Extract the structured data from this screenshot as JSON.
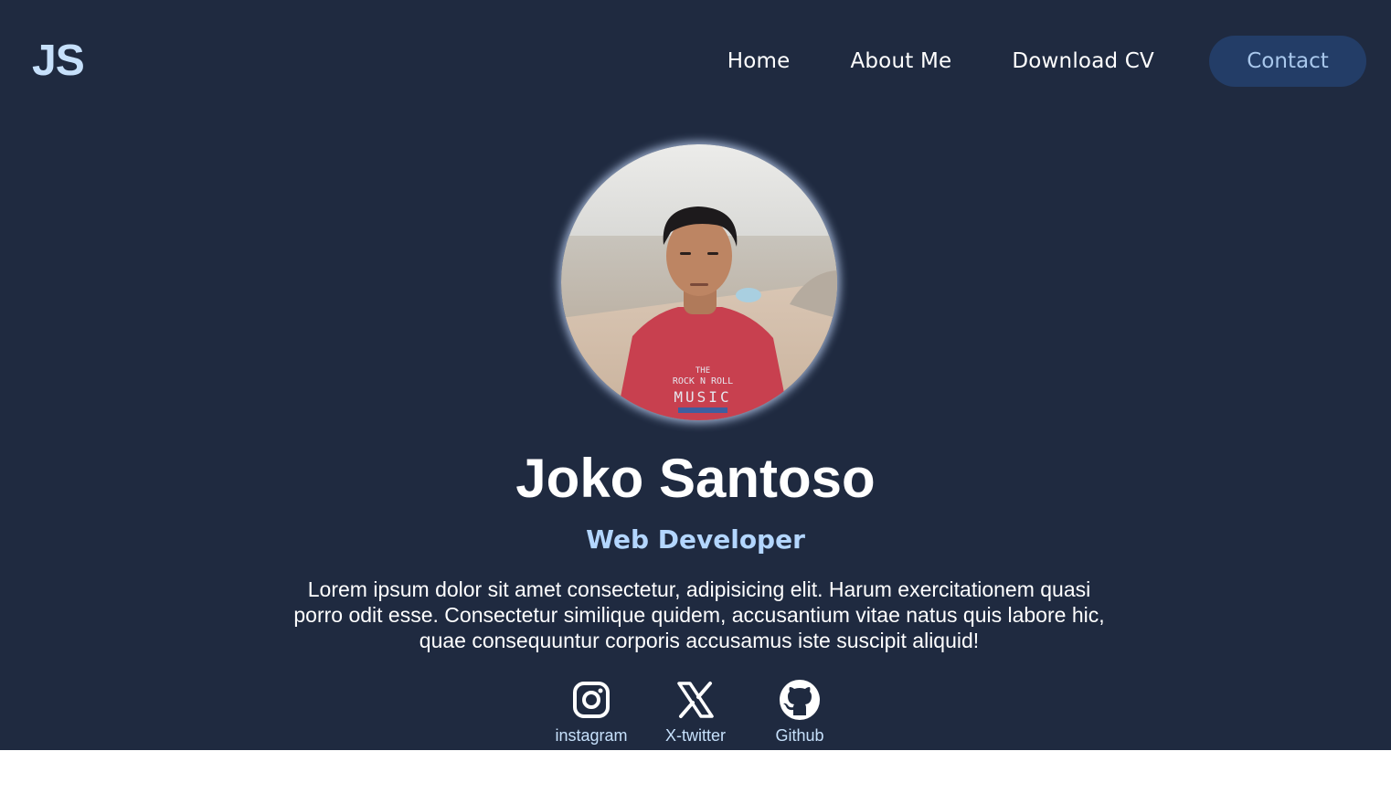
{
  "brand": {
    "logo": "JS"
  },
  "nav": {
    "items": [
      {
        "label": "Home"
      },
      {
        "label": "About Me"
      },
      {
        "label": "Download CV"
      }
    ],
    "contact_label": "Contact"
  },
  "profile": {
    "name": "Joko Santoso",
    "role": "Web Developer",
    "bio": "Lorem ipsum dolor sit amet consectetur, adipisicing elit. Harum exercitationem quasi porro odit esse. Consectetur similique quidem, accusantium vitae natus quis labore hic, quae consequuntur corporis accusamus iste suscipit aliquid!",
    "photo_shirt_text": [
      "THE",
      "ROCK N ROLL",
      "MUSIC"
    ]
  },
  "socials": [
    {
      "label": "instagram",
      "icon": "instagram-icon"
    },
    {
      "label": "X-twitter",
      "icon": "x-twitter-icon"
    },
    {
      "label": "Github",
      "icon": "github-icon"
    }
  ],
  "colors": {
    "background": "#1f2a40",
    "accent": "#b3d6ff",
    "button": "#233d67",
    "page_bottom": "#ffffff"
  }
}
